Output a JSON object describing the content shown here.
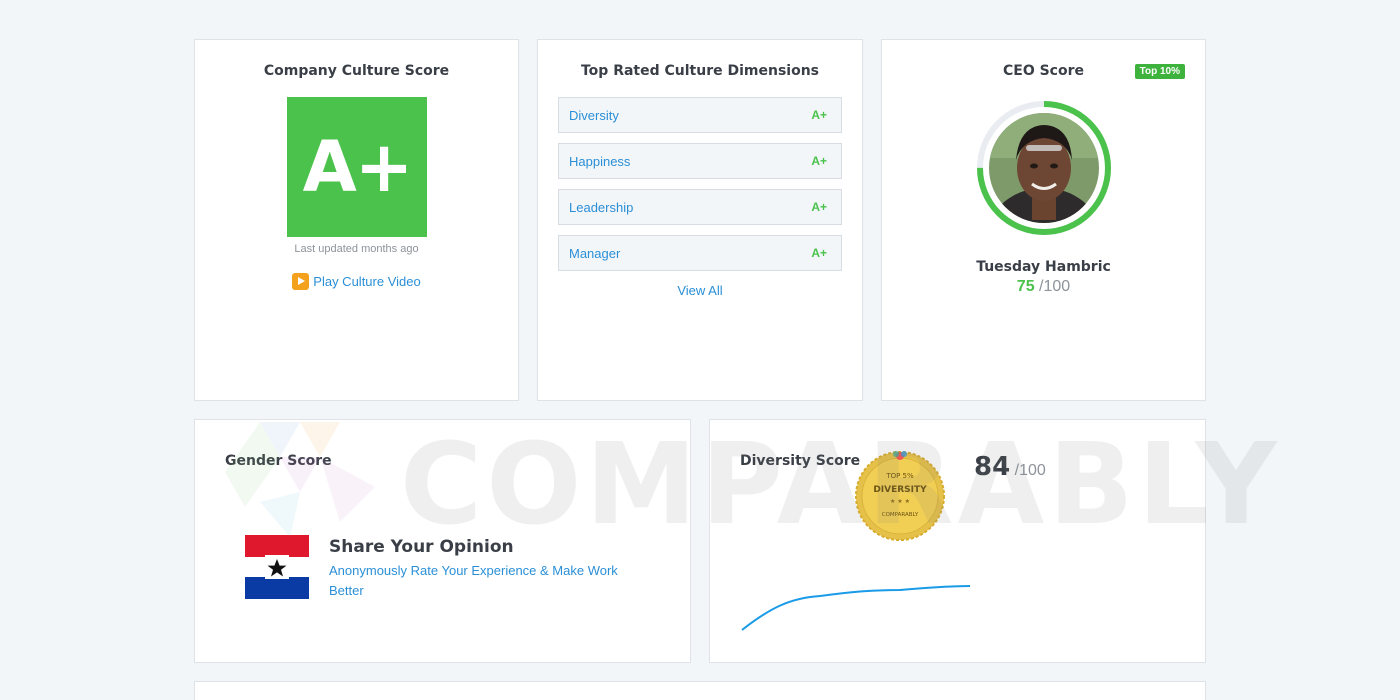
{
  "company_culture": {
    "title": "Company Culture Score",
    "grade": "A+",
    "updated": "Last updated months ago",
    "video_label": "Play Culture Video"
  },
  "top_rated": {
    "title": "Top Rated Culture Dimensions",
    "items": [
      {
        "label": "Diversity",
        "grade": "A+"
      },
      {
        "label": "Happiness",
        "grade": "A+"
      },
      {
        "label": "Leadership",
        "grade": "A+"
      },
      {
        "label": "Manager",
        "grade": "A+"
      }
    ],
    "view_all": "View All"
  },
  "ceo": {
    "title": "CEO Score",
    "badge": "Top 10%",
    "name": "Tuesday Hambric",
    "score": "75",
    "score_max": "/100",
    "score_fraction": 0.75
  },
  "gender": {
    "title": "Gender Score",
    "opinion_title": "Share Your Opinion",
    "opinion_sub": "Anonymously Rate Your Experience & Make Work Better"
  },
  "diversity": {
    "title": "Diversity Score",
    "score": "84",
    "score_max": "/100",
    "seal_lines": [
      "TOP 5%",
      "DIVERSITY",
      "COMPARABLY"
    ]
  },
  "watermark": "COMPARABLY",
  "colors": {
    "accent_green": "#4bc24b",
    "link_blue": "#2b8fd6",
    "video_orange": "#f4a11d",
    "trend_blue": "#1a9be8"
  }
}
